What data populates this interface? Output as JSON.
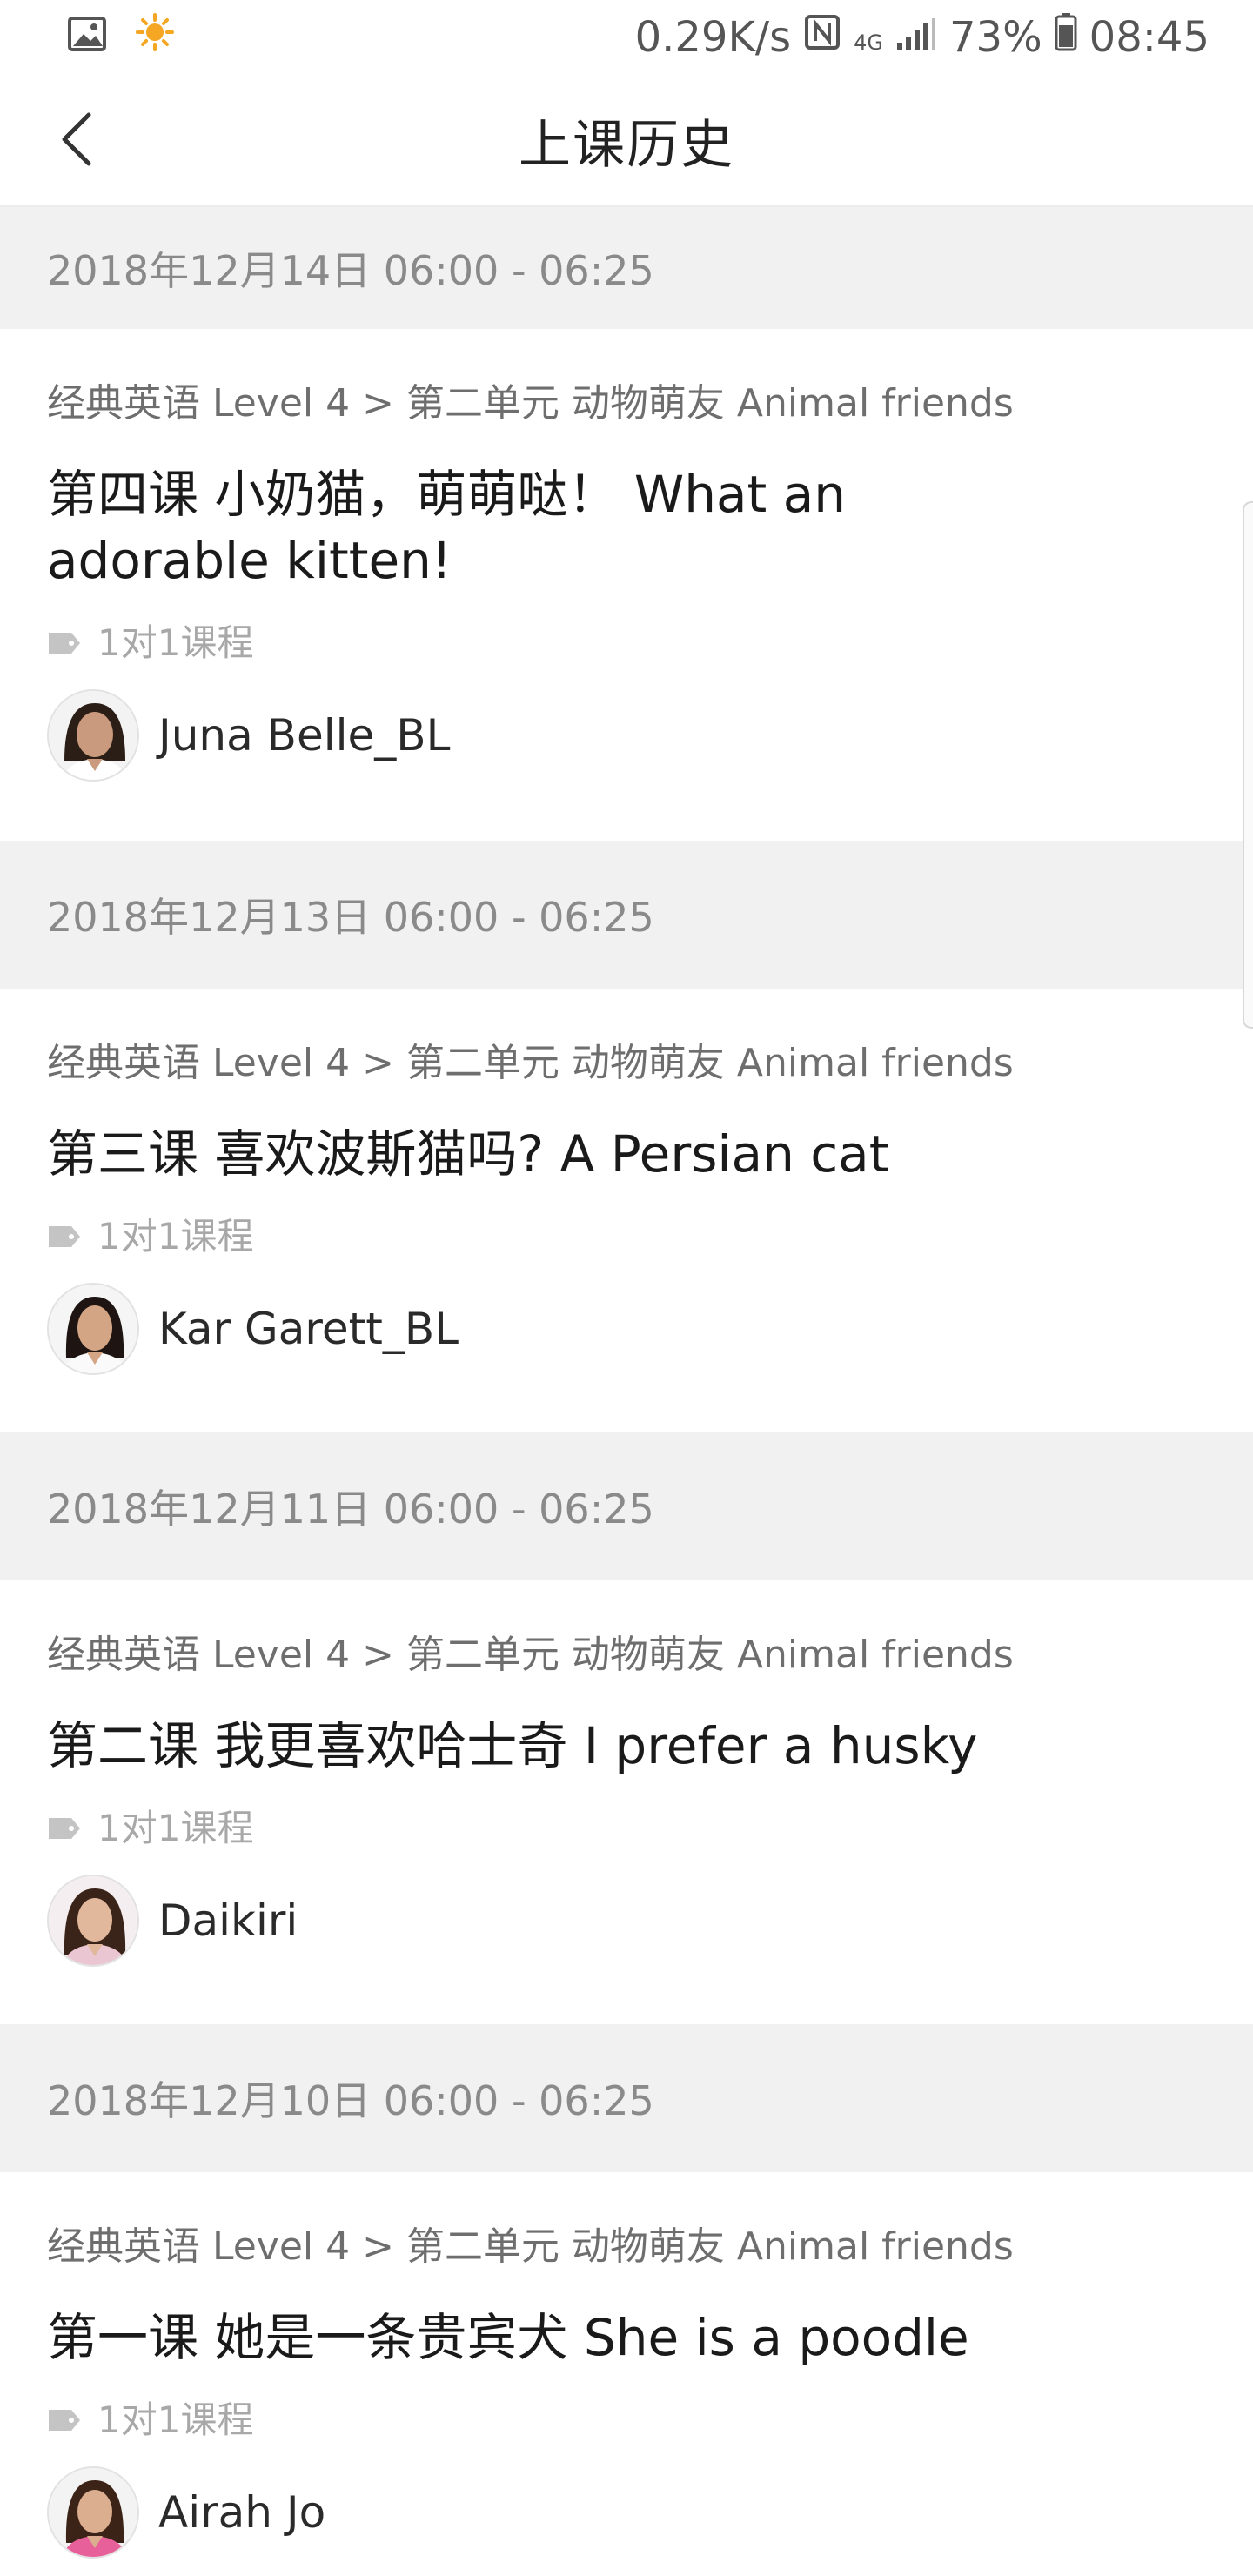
{
  "status_bar": {
    "net_speed": "0.29K/s",
    "network": "4G",
    "battery": "73%",
    "time": "08:45"
  },
  "header": {
    "title": "上课历史"
  },
  "lessons": [
    {
      "date": "2018年12月14日 06:00 - 06:25",
      "course_path": "经典英语 Level 4 > 第二单元 动物萌友 Animal friends",
      "title": "第四课 小奶猫，萌萌哒！ What an adorable kitten!",
      "tag": "1对1课程",
      "teacher": "Juna Belle_BL"
    },
    {
      "date": "2018年12月13日 06:00 - 06:25",
      "course_path": "经典英语 Level 4 > 第二单元 动物萌友 Animal friends",
      "title": "第三课 喜欢波斯猫吗? A Persian cat",
      "tag": "1对1课程",
      "teacher": "Kar Garett_BL"
    },
    {
      "date": "2018年12月11日 06:00 - 06:25",
      "course_path": "经典英语 Level 4 > 第二单元 动物萌友 Animal friends",
      "title": "第二课 我更喜欢哈士奇 I prefer a husky",
      "tag": "1对1课程",
      "teacher": "Daikiri"
    },
    {
      "date": "2018年12月10日 06:00 - 06:25",
      "course_path": "经典英语 Level 4 > 第二单元 动物萌友 Animal friends",
      "title": "第一课 她是一条贵宾犬 She is a poodle",
      "tag": "1对1课程",
      "teacher": "Airah Jo"
    }
  ],
  "icons": {
    "status_left": [
      "gallery-icon",
      "weather-sun-icon"
    ],
    "status_right": [
      "nfc-icon",
      "signal-icon",
      "battery-icon"
    ],
    "header": "back-chevron-icon",
    "tag": "tag-icon"
  },
  "colors": {
    "date_bar_bg": "#f1f1f1",
    "date_text": "#8a8a8a",
    "tag_text": "#a8a8a8"
  }
}
